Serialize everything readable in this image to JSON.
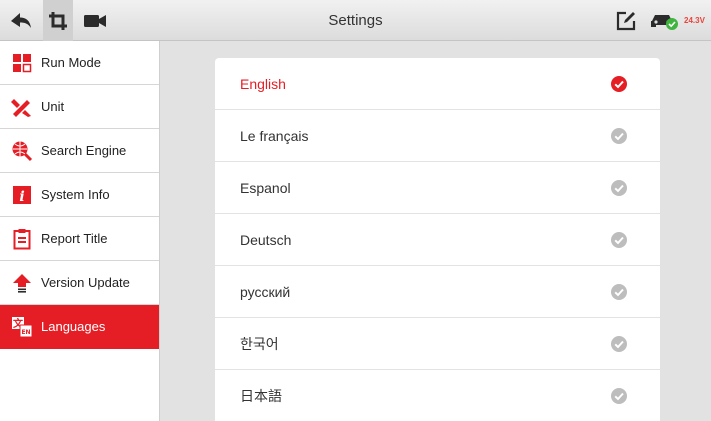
{
  "header": {
    "title": "Settings",
    "voltage": "24.3V",
    "icons": [
      "back-arrow-icon",
      "crop-screenshot-icon",
      "video-camera-icon",
      "edit-icon",
      "vehicle-connection-icon"
    ]
  },
  "sidebar": {
    "items": [
      {
        "label": "Run Mode",
        "icon": "run-mode-icon"
      },
      {
        "label": "Unit",
        "icon": "unit-icon"
      },
      {
        "label": "Search Engine",
        "icon": "search-engine-icon"
      },
      {
        "label": "System Info",
        "icon": "system-info-icon"
      },
      {
        "label": "Report Title",
        "icon": "report-title-icon"
      },
      {
        "label": "Version Update",
        "icon": "version-update-icon"
      },
      {
        "label": "Languages",
        "icon": "languages-icon",
        "active": true
      }
    ]
  },
  "languages": {
    "selected": "English",
    "items": [
      "English",
      "Le français",
      "Espanol",
      "Deutsch",
      "русский",
      "한국어",
      "日本語"
    ]
  },
  "colors": {
    "accent": "#e51e25",
    "check_inactive": "#bdbdbd",
    "background": "#e2e2e2"
  }
}
